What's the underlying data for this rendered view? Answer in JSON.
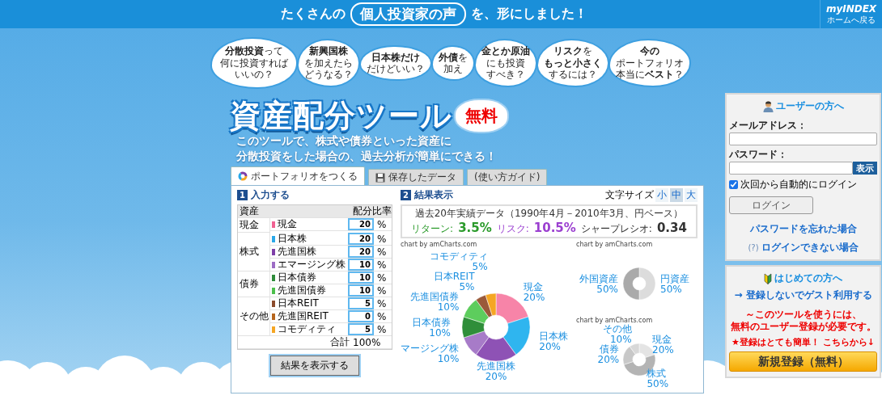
{
  "header": {
    "lead": "たくさんの",
    "highlight": "個人投資家の声",
    "tail": "を、形にしました！",
    "logo": "myINDEX",
    "home_link": "ホームへ戻る"
  },
  "bubbles": [
    {
      "lines": [
        "**分散投資**って",
        "何に投資すれば",
        "いいの？"
      ]
    },
    {
      "lines": [
        "**新興国株**",
        "を加えたら",
        "どうなる？"
      ]
    },
    {
      "lines": [
        "**日本株だけ**",
        "だけどいい？"
      ]
    },
    {
      "lines": [
        "**外債**を",
        "加え"
      ]
    },
    {
      "lines": [
        "**金とか原油**",
        "にも投資",
        "すべき？"
      ]
    },
    {
      "lines": [
        "**リスク**を",
        "**もっと小さく**",
        "するには？"
      ]
    },
    {
      "lines": [
        "**今の**",
        "ポートフォリオ",
        "本当に**ベスト**？"
      ]
    }
  ],
  "hero": {
    "title": "資産配分ツール",
    "badge": "無料",
    "lines": [
      "このツールで、**株式や債券**といった**資産**に",
      "**分散投資**をした場合の、**過去分析**が**簡単**にできる！"
    ]
  },
  "tool": {
    "tabs": [
      {
        "label": "ポートフォリオをつくる",
        "selected": true
      },
      {
        "label": "保存したデータ",
        "selected": false
      },
      {
        "label": "(使い方ガイド)",
        "selected": false
      }
    ],
    "input_section": {
      "number": "1",
      "title": "入力する"
    },
    "table": {
      "columns": [
        "資産",
        "配分比率"
      ],
      "groups": [
        {
          "label": "現金",
          "assets": [
            {
              "name": "現金",
              "color": "#f06292",
              "value": "20",
              "unit": "%"
            }
          ]
        },
        {
          "label": "株式",
          "assets": [
            {
              "name": "日本株",
              "color": "#29a8e8",
              "value": "20",
              "unit": "%"
            },
            {
              "name": "先進国株",
              "color": "#7e3fa8",
              "value": "20",
              "unit": "%"
            },
            {
              "name": "エマージング株",
              "color": "#9c6cc4",
              "value": "10",
              "unit": "%"
            }
          ]
        },
        {
          "label": "債券",
          "assets": [
            {
              "name": "日本債券",
              "color": "#2e8b3a",
              "value": "10",
              "unit": "%"
            },
            {
              "name": "先進国債券",
              "color": "#4cbf4c",
              "value": "10",
              "unit": "%"
            }
          ]
        },
        {
          "label": "その他",
          "assets": [
            {
              "name": "日本REIT",
              "color": "#8b4a2b",
              "value": "5",
              "unit": "%"
            },
            {
              "name": "先進国REIT",
              "color": "#b5651d",
              "value": "0",
              "unit": "%"
            },
            {
              "name": "コモディティ",
              "color": "#f5a623",
              "value": "5",
              "unit": "%"
            }
          ]
        }
      ],
      "total_label": "合計",
      "total": "100%"
    },
    "submit": "結果を表示する",
    "result_section": {
      "number": "2",
      "title": "結果表示"
    },
    "font_size": {
      "label": "文字サイズ",
      "options": [
        {
          "label": "小",
          "selected": false
        },
        {
          "label": "中",
          "selected": true
        },
        {
          "label": "大",
          "selected": false
        }
      ]
    },
    "summary": {
      "caption": "過去20年実績データ（1990年4月－2010年3月、円ベース）",
      "metrics": [
        {
          "label": "リターン:",
          "value": "3.5%",
          "color": "#2a9a2a"
        },
        {
          "label": "リスク:",
          "value": "10.5%",
          "color": "#9b3fd0"
        },
        {
          "label": "シャープレシオ:",
          "value": "0.34",
          "color": "#333333"
        }
      ]
    },
    "charts": [
      {
        "chart_data": {
          "type": "donut",
          "title": "chart by amCharts.com",
          "categories": [
            "現金",
            "日本株",
            "先進国株",
            "マージング株",
            "日本債券",
            "先進国債券",
            "日本REIT",
            "コモディティ"
          ],
          "values": [
            20,
            20,
            20,
            10,
            10,
            10,
            5,
            5
          ],
          "colors": [
            "#f784a8",
            "#2fb5ef",
            "#8e52b5",
            "#a77bc8",
            "#2f8e3a",
            "#5dcd5d",
            "#9a5a3a",
            "#f5a623"
          ],
          "value_labels": [
            "20%",
            "20%",
            "20%",
            "10%",
            "10%",
            "10%",
            "5%",
            "5%"
          ]
        }
      },
      {
        "chart_data": {
          "type": "donut",
          "title": "chart by amCharts.com",
          "categories": [
            "円資産",
            "外国資産"
          ],
          "values": [
            50,
            50
          ],
          "colors": [
            "#dcdcdc",
            "#aaaaaa"
          ],
          "value_labels": [
            "50%",
            "50%"
          ]
        }
      },
      {
        "chart_data": {
          "type": "donut",
          "title": "chart by amCharts.com",
          "categories": [
            "現金",
            "株式",
            "債券",
            "その他"
          ],
          "values": [
            20,
            50,
            20,
            10
          ],
          "colors": [
            "#e4e4e4",
            "#b4b4b4",
            "#c8c8c8",
            "#d8d8d8"
          ],
          "value_labels": [
            "20%",
            "50%",
            "20%",
            "10%"
          ]
        }
      }
    ]
  },
  "login": {
    "title": "ユーザーの方へ",
    "email_label": "メールアドレス：",
    "password_label": "パスワード：",
    "show_button": "表示",
    "remember": {
      "label": "次回から自動的にログイン",
      "checked": true
    },
    "login_button": "ログイン",
    "forgot_link": "パスワードを忘れた場合",
    "help_mark": "(?)",
    "help_link": "ログインできない場合"
  },
  "newcomer": {
    "title": "はじめての方へ",
    "guest_link": "→ 登録しないでゲスト利用する",
    "notice": [
      "～このツールを使うには、",
      "無料のユーザー登録が必要です。"
    ],
    "cta_note": "★登録はとても簡単！ こちらから↓",
    "register_button": "新規登録（無料）"
  }
}
